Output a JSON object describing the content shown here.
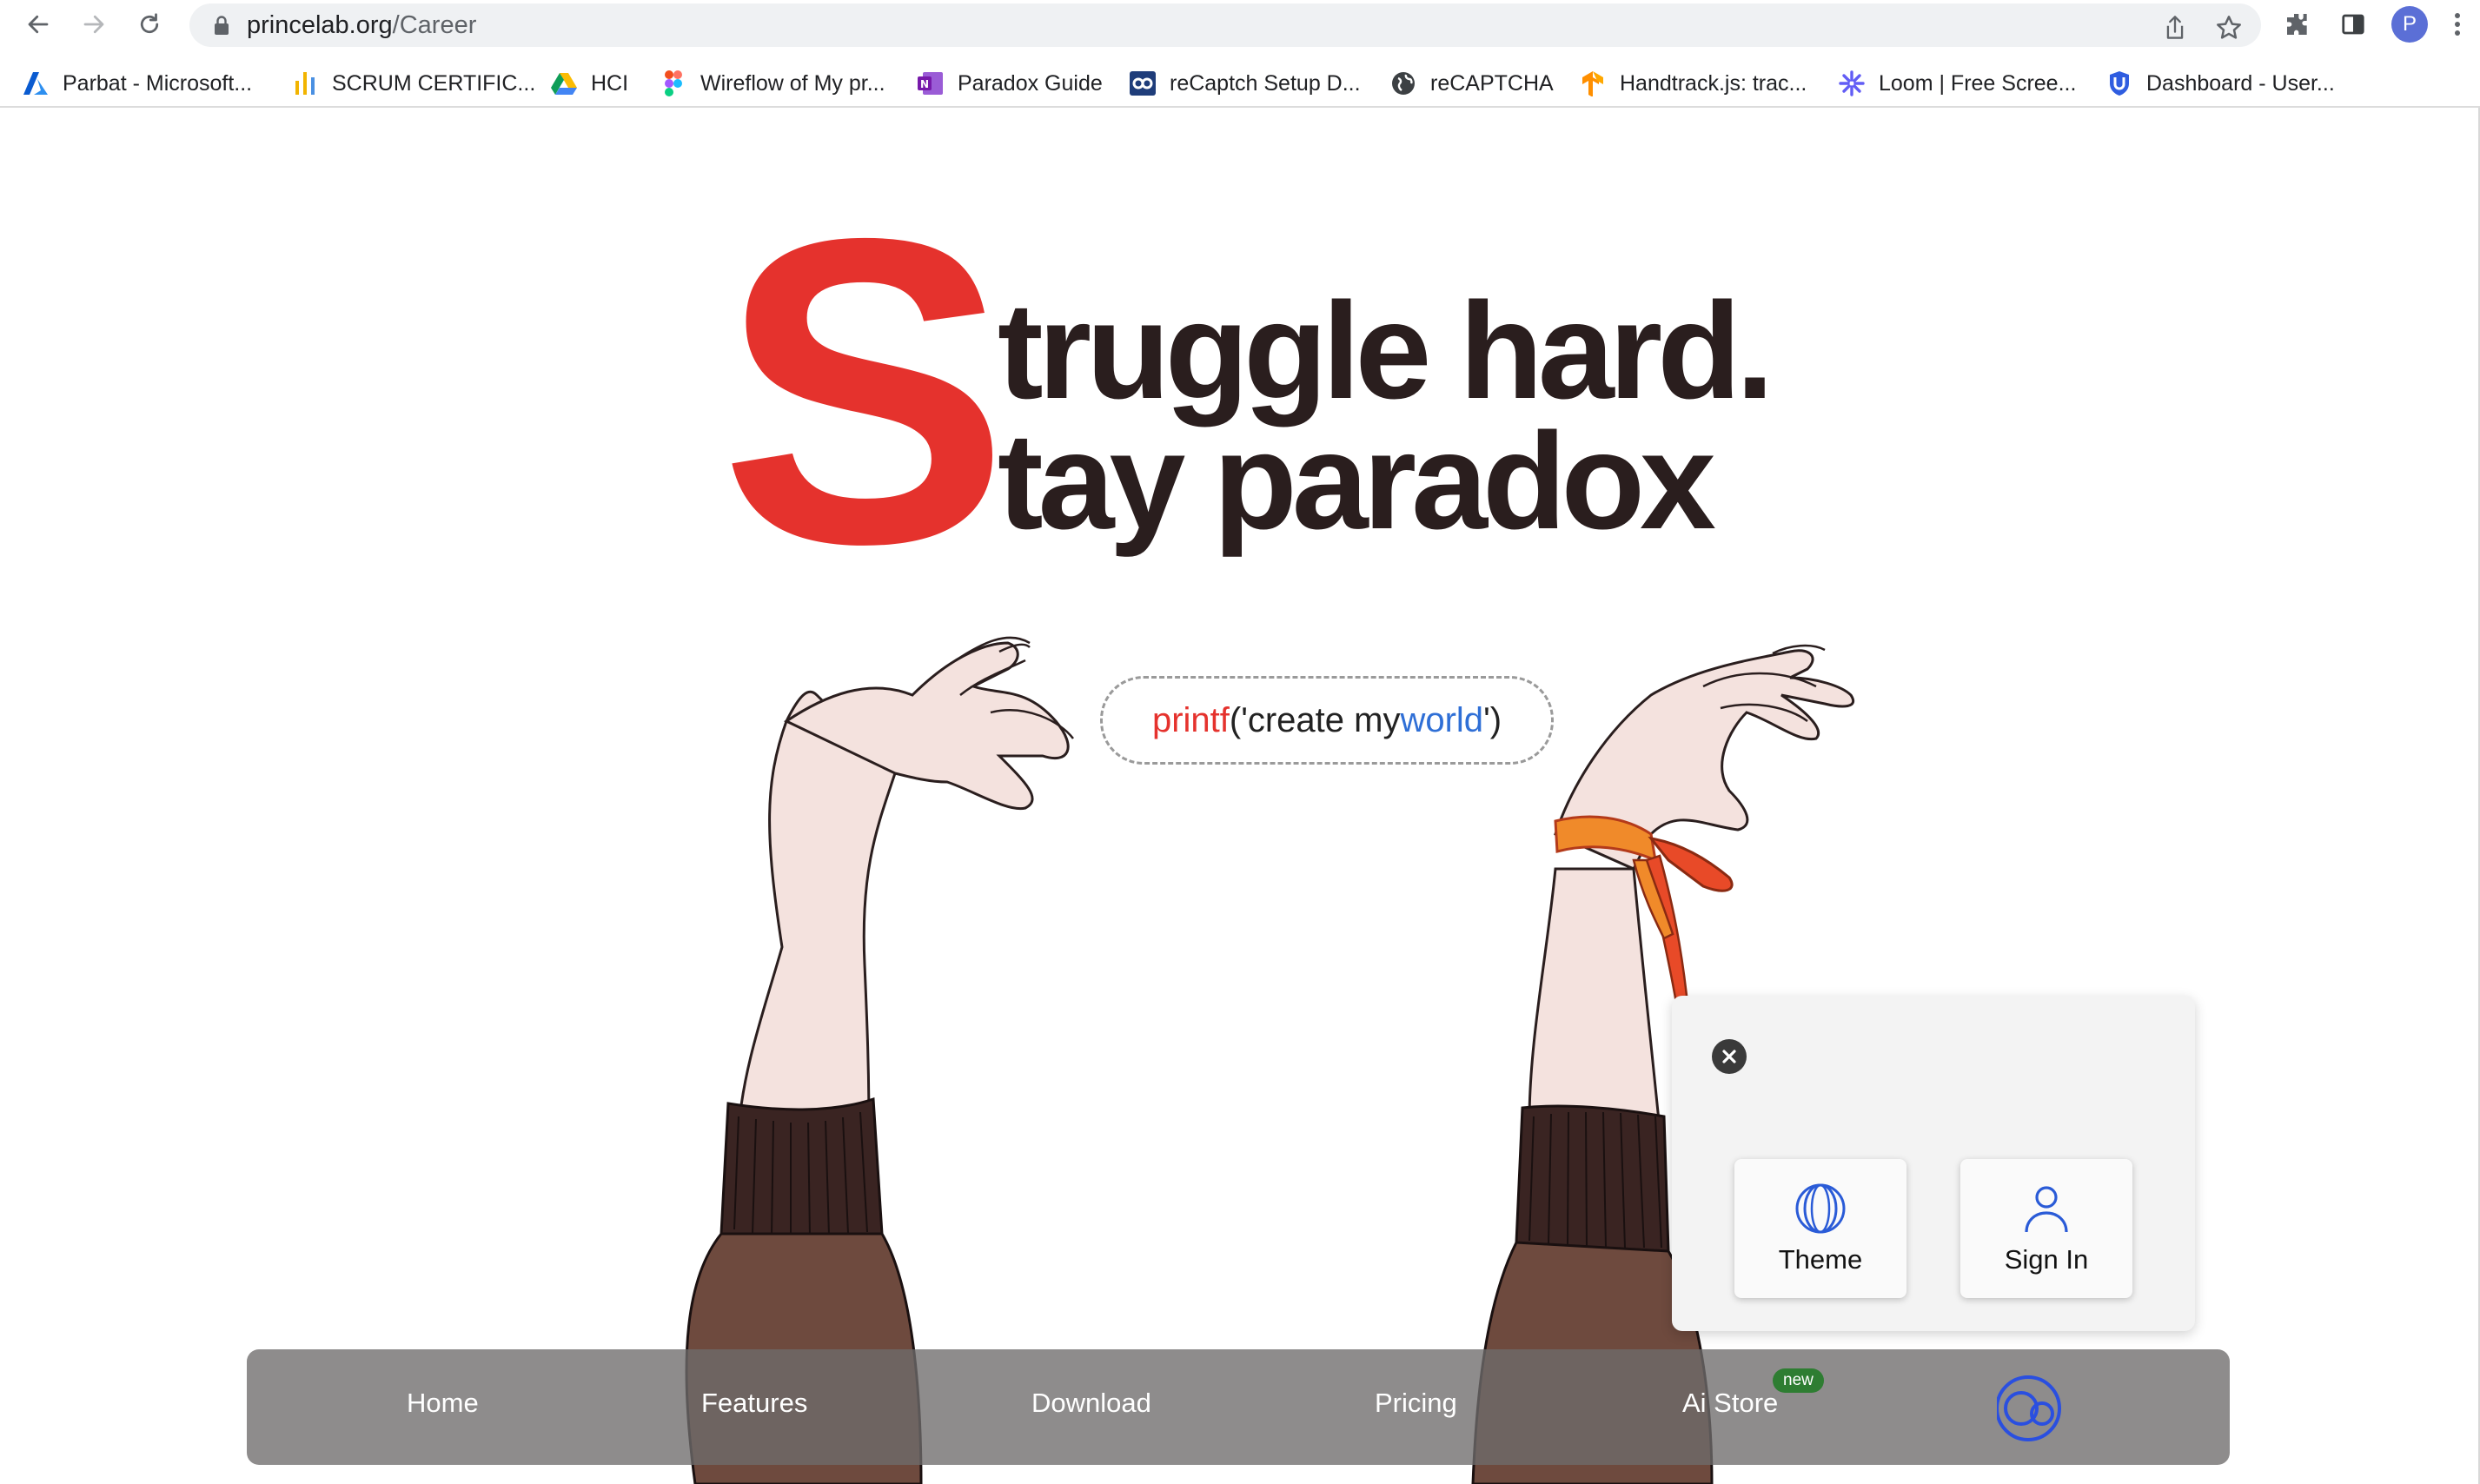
{
  "browser": {
    "url_host": "princelab.org",
    "url_path": "/Career",
    "profile_initial": "P"
  },
  "bookmarks": [
    {
      "label": "Parbat - Microsoft...",
      "icon": "azure-icon"
    },
    {
      "label": "SCRUM CERTIFIC...",
      "icon": "bars-chart-icon"
    },
    {
      "label": "HCI",
      "icon": "google-drive-icon"
    },
    {
      "label": "Wireflow of My pr...",
      "icon": "figma-icon"
    },
    {
      "label": "Paradox Guide",
      "icon": "onenote-icon"
    },
    {
      "label": "reCaptch Setup D...",
      "icon": "cloud-icon"
    },
    {
      "label": "reCAPTCHA",
      "icon": "globe-icon"
    },
    {
      "label": "Handtrack.js: trac...",
      "icon": "tensorflow-icon"
    },
    {
      "label": "Loom | Free Scree...",
      "icon": "loom-icon"
    },
    {
      "label": "Dashboard - User...",
      "icon": "shield-u-icon"
    }
  ],
  "hero": {
    "big_letter": "S",
    "line1": "truggle hard.",
    "line2": "tay paradox"
  },
  "code_pill": {
    "fn": "printf",
    "open": "('create my ",
    "world": "world",
    "close": "')"
  },
  "popup": {
    "theme_label": "Theme",
    "signin_label": "Sign In"
  },
  "bottom_nav": {
    "items": [
      "Home",
      "Features",
      "Download",
      "Pricing",
      "Ai Store"
    ],
    "badge": "new"
  },
  "colors": {
    "accent_red": "#e5322d",
    "accent_blue": "#2f6fd6",
    "heading_dark": "#2a1e1e",
    "badge_green": "#2e7d32"
  }
}
